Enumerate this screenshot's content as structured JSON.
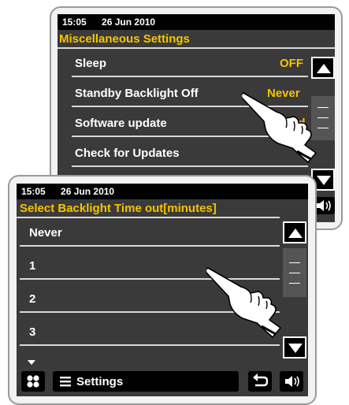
{
  "back_screen": {
    "time": "15:05",
    "date": "26 Jun 2010",
    "title": "Miscellaneous Settings",
    "items": [
      {
        "label": "Sleep",
        "value": "OFF"
      },
      {
        "label": "Standby Backlight Off",
        "value": "Never"
      },
      {
        "label": "Software update",
        "value": "E____d"
      },
      {
        "label": "Check for Updates",
        "value": ""
      }
    ]
  },
  "front_screen": {
    "time": "15:05",
    "date": "26 Jun 2010",
    "title": "Select Backlight Time out[minutes]",
    "options": [
      {
        "label": "Never"
      },
      {
        "label": "1"
      },
      {
        "label": "2"
      },
      {
        "label": "3"
      }
    ],
    "settings_label": "Settings"
  },
  "icons": {
    "up": "triangle-up-icon",
    "down": "triangle-down-icon",
    "volume": "speaker-icon",
    "home": "four-dots-icon",
    "menu": "hamburger-icon",
    "back": "return-arrow-icon",
    "scroll": "scroll-indicator-icon"
  },
  "colors": {
    "accent": "#f5c400",
    "screen_bg": "#3a3a3a",
    "bar_bg": "#000000"
  }
}
